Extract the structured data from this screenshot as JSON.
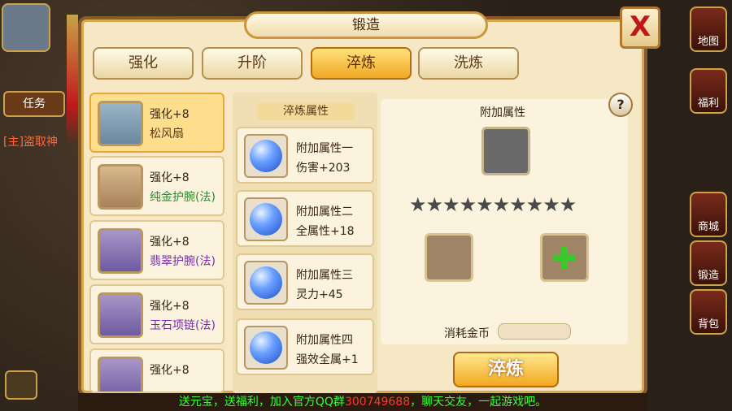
{
  "window": {
    "title": "锻造",
    "close_label": "X"
  },
  "tabs": [
    {
      "label": "强化"
    },
    {
      "label": "升阶"
    },
    {
      "label": "淬炼",
      "active": true
    },
    {
      "label": "洗炼"
    }
  ],
  "equipment": [
    {
      "level": "强化+8",
      "name": "松风扇",
      "color": "#5a3a18",
      "icon": "fan-icon",
      "selected": true
    },
    {
      "level": "强化+8",
      "name": "纯金护腕(法)",
      "color": "#2a8a2a",
      "icon": "bracer-icon"
    },
    {
      "level": "强化+8",
      "name": "翡翠护腕(法)",
      "color": "#7a2aa8",
      "icon": "bracer-icon"
    },
    {
      "level": "强化+8",
      "name": "玉石项链(法)",
      "color": "#7a2aa8",
      "icon": "necklace-icon"
    },
    {
      "level": "强化+8",
      "name": "",
      "color": "#7a2aa8",
      "icon": "ring-icon"
    }
  ],
  "attributes": {
    "header": "淬炼属性",
    "items": [
      {
        "name": "附加属性一",
        "value": "伤害+203"
      },
      {
        "name": "附加属性二",
        "value": "全属性+18"
      },
      {
        "name": "附加属性三",
        "value": "灵力+45"
      },
      {
        "name": "附加属性四",
        "value": "强效全属+1"
      }
    ]
  },
  "detail": {
    "title": "附加属性",
    "help": "?",
    "stars": "★★★★★★★★★★",
    "star_count": 10,
    "cost_label": "消耗金币",
    "cost_value": "",
    "add_icon": "plus-icon"
  },
  "forge_button": "淬炼",
  "side_menu": [
    {
      "label": "地图"
    },
    {
      "label": "福利"
    },
    {
      "label": "商城"
    },
    {
      "label": "锻造"
    },
    {
      "label": "背包"
    }
  ],
  "hud": {
    "task_tab": "任务",
    "chat_line": "[主]盗取神"
  },
  "announcement": {
    "text_a": "送元宝，送福利，加入官方QQ群",
    "qq": "300749688",
    "text_b": "，聊天交友，一起游戏吧。"
  },
  "colors": {
    "accent": "#f2a820",
    "qq": "#ff3a2a",
    "announce": "#3aff3a"
  }
}
